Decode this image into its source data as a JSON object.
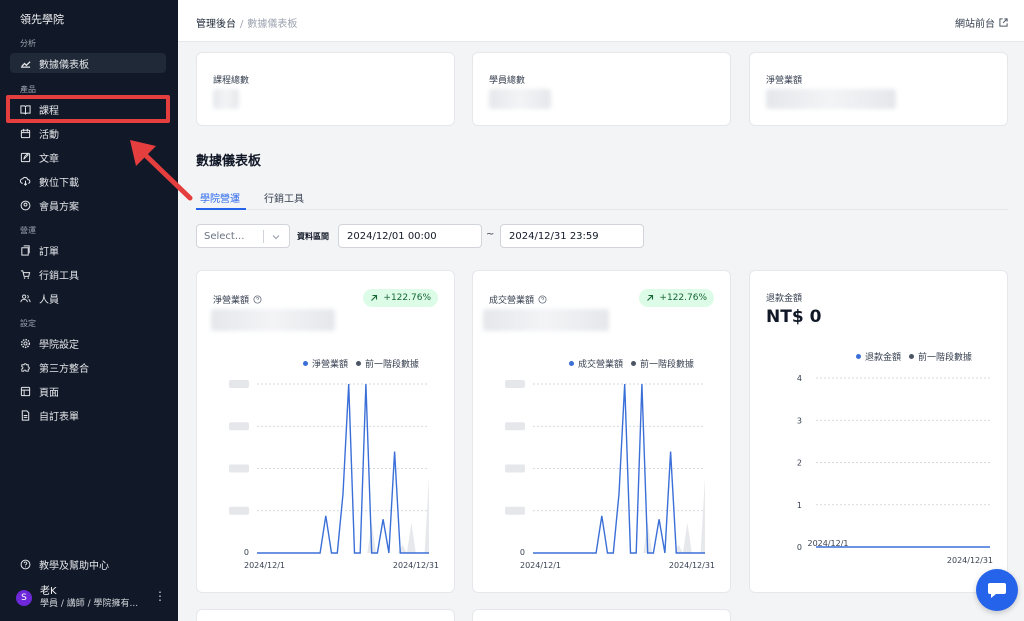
{
  "sidebar": {
    "brand": "領先學院",
    "groups": {
      "analytics": "分析",
      "products": "產品",
      "operations": "營運",
      "settings": "設定"
    },
    "items": {
      "dashboard": "數據儀表板",
      "courses": "課程",
      "events": "活動",
      "articles": "文章",
      "downloads": "數位下載",
      "membership": "會員方案",
      "orders": "訂單",
      "marketing": "行銷工具",
      "members": "人員",
      "academy_settings": "學院設定",
      "integrations": "第三方整合",
      "pages": "頁面",
      "forms": "自訂表單"
    },
    "help": "教學及幫助中心",
    "user": {
      "avatar": "S",
      "name": "老K",
      "role": "學員 / 講師 / 學院擁有..."
    }
  },
  "header": {
    "breadcrumb_root": "管理後台",
    "breadcrumb_sep": "/",
    "breadcrumb_current": "數據儀表板",
    "site_link": "網站前台"
  },
  "stats": [
    {
      "label": "課程總數"
    },
    {
      "label": "學員總數"
    },
    {
      "label": "淨營業額"
    }
  ],
  "section_title": "數據儀表板",
  "tabs": [
    "學院營運",
    "行銷工具"
  ],
  "filters": {
    "select_placeholder": "Select...",
    "range_label": "資料區間",
    "start": "2024/12/01 00:00",
    "tilde": "~",
    "end": "2024/12/31 23:59"
  },
  "colors": {
    "accent": "#2563eb",
    "current_series": "#3b6fd8",
    "previous_series": "#6b7280",
    "badge_bg": "#dcfce7"
  },
  "charts": [
    {
      "title": "淨營業額",
      "badge": "+122.76%",
      "legend": [
        "淨營業額",
        "前一階段數據"
      ],
      "x_start": "2024/12/1",
      "x_end": "2024/12/31",
      "y_zero": "0"
    },
    {
      "title": "成交營業額",
      "badge": "+122.76%",
      "legend": [
        "成交營業額",
        "前一階段數據"
      ],
      "x_start": "2024/12/1",
      "x_end": "2024/12/31",
      "y_zero": "0"
    },
    {
      "title": "退款金額",
      "value": "NT$ 0",
      "legend": [
        "退款金額",
        "前一階段數據"
      ],
      "x_start": "2024/12/1",
      "x_end": "2024/12/31",
      "y_ticks": [
        "4",
        "3",
        "2",
        "1",
        "0"
      ]
    }
  ],
  "chart_data": [
    {
      "type": "line",
      "title": "淨營業額",
      "series": [
        {
          "name": "淨營業額",
          "values": [
            0,
            0,
            0,
            0,
            0,
            0,
            0,
            0,
            0,
            0,
            0,
            0,
            0.22,
            0,
            0,
            0.35,
            1,
            0,
            0,
            1,
            0,
            0,
            0.2,
            0,
            0.6,
            0,
            0,
            0,
            0,
            0,
            0
          ]
        },
        {
          "name": "前一階段數據",
          "values": [
            0,
            0,
            0,
            0,
            0,
            0,
            0,
            0,
            0,
            0,
            0,
            0,
            0,
            0,
            0,
            0,
            0,
            0,
            0,
            0,
            0,
            0,
            0,
            0,
            0,
            0,
            0.18,
            0,
            0,
            0,
            0,
            0,
            0,
            0.05,
            0,
            0.18,
            0,
            0,
            0,
            0.45
          ]
        }
      ]
    },
    {
      "type": "line",
      "title": "成交營業額",
      "series": [
        {
          "name": "成交營業額",
          "values": [
            0,
            0,
            0,
            0,
            0,
            0,
            0,
            0,
            0,
            0,
            0,
            0,
            0.22,
            0,
            0,
            0.35,
            1,
            0,
            0,
            1,
            0,
            0,
            0.2,
            0,
            0.6,
            0,
            0,
            0,
            0,
            0,
            0
          ]
        },
        {
          "name": "前一階段數據",
          "values": [
            0,
            0,
            0,
            0,
            0,
            0,
            0,
            0,
            0,
            0,
            0,
            0,
            0,
            0,
            0,
            0,
            0,
            0,
            0,
            0,
            0,
            0,
            0,
            0,
            0,
            0,
            0.18,
            0,
            0,
            0,
            0,
            0,
            0,
            0.05,
            0,
            0.18,
            0,
            0,
            0,
            0.45
          ]
        }
      ]
    },
    {
      "type": "line",
      "title": "退款金額",
      "ylim": [
        0,
        4
      ],
      "series": [
        {
          "name": "退款金額",
          "values": [
            0,
            0,
            0,
            0,
            0,
            0,
            0,
            0,
            0,
            0,
            0,
            0,
            0,
            0,
            0,
            0,
            0,
            0,
            0,
            0,
            0,
            0,
            0,
            0,
            0,
            0,
            0,
            0,
            0,
            0,
            0
          ]
        }
      ]
    }
  ]
}
